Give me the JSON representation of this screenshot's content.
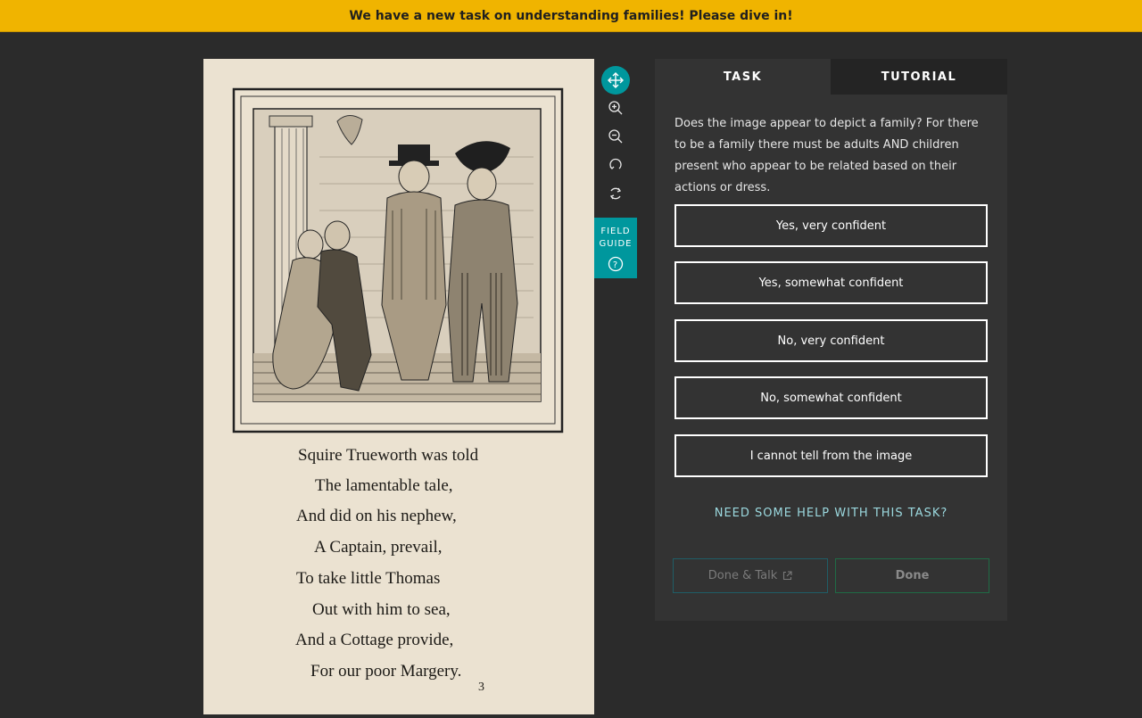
{
  "banner": {
    "text": "We have a new task on understanding families! Please dive in!",
    "background": "#f0b400"
  },
  "subject": {
    "poem": [
      "Squire Trueworth was told",
      "The lamentable tale,",
      "And did on his nephew,",
      "A Captain, prevail,",
      "To take little Thomas",
      "Out with him to sea,",
      "And a Cottage provide,",
      "For our poor Margery."
    ],
    "page_number": "3"
  },
  "toolbar": {
    "tools": [
      {
        "name": "move-icon",
        "active": true
      },
      {
        "name": "zoom-in-icon",
        "active": false
      },
      {
        "name": "zoom-out-icon",
        "active": false
      },
      {
        "name": "rotate-icon",
        "active": false
      },
      {
        "name": "reset-icon",
        "active": false
      }
    ],
    "field_guide_label": "FIELD\nGUIDE",
    "accent": "#00979d"
  },
  "panel": {
    "tabs": [
      {
        "label": "TASK",
        "active": true
      },
      {
        "label": "TUTORIAL",
        "active": false
      }
    ],
    "question": "Does the image appear to depict a family? For there to be a family there must be adults AND children present who appear to be related based on their actions or dress.",
    "answers": [
      "Yes, very confident",
      "Yes, somewhat confident",
      "No, very confident",
      "No, somewhat confident",
      "I cannot tell from the image"
    ],
    "help_link": "NEED SOME HELP WITH THIS TASK?",
    "done_talk_label": "Done & Talk",
    "done_label": "Done"
  }
}
